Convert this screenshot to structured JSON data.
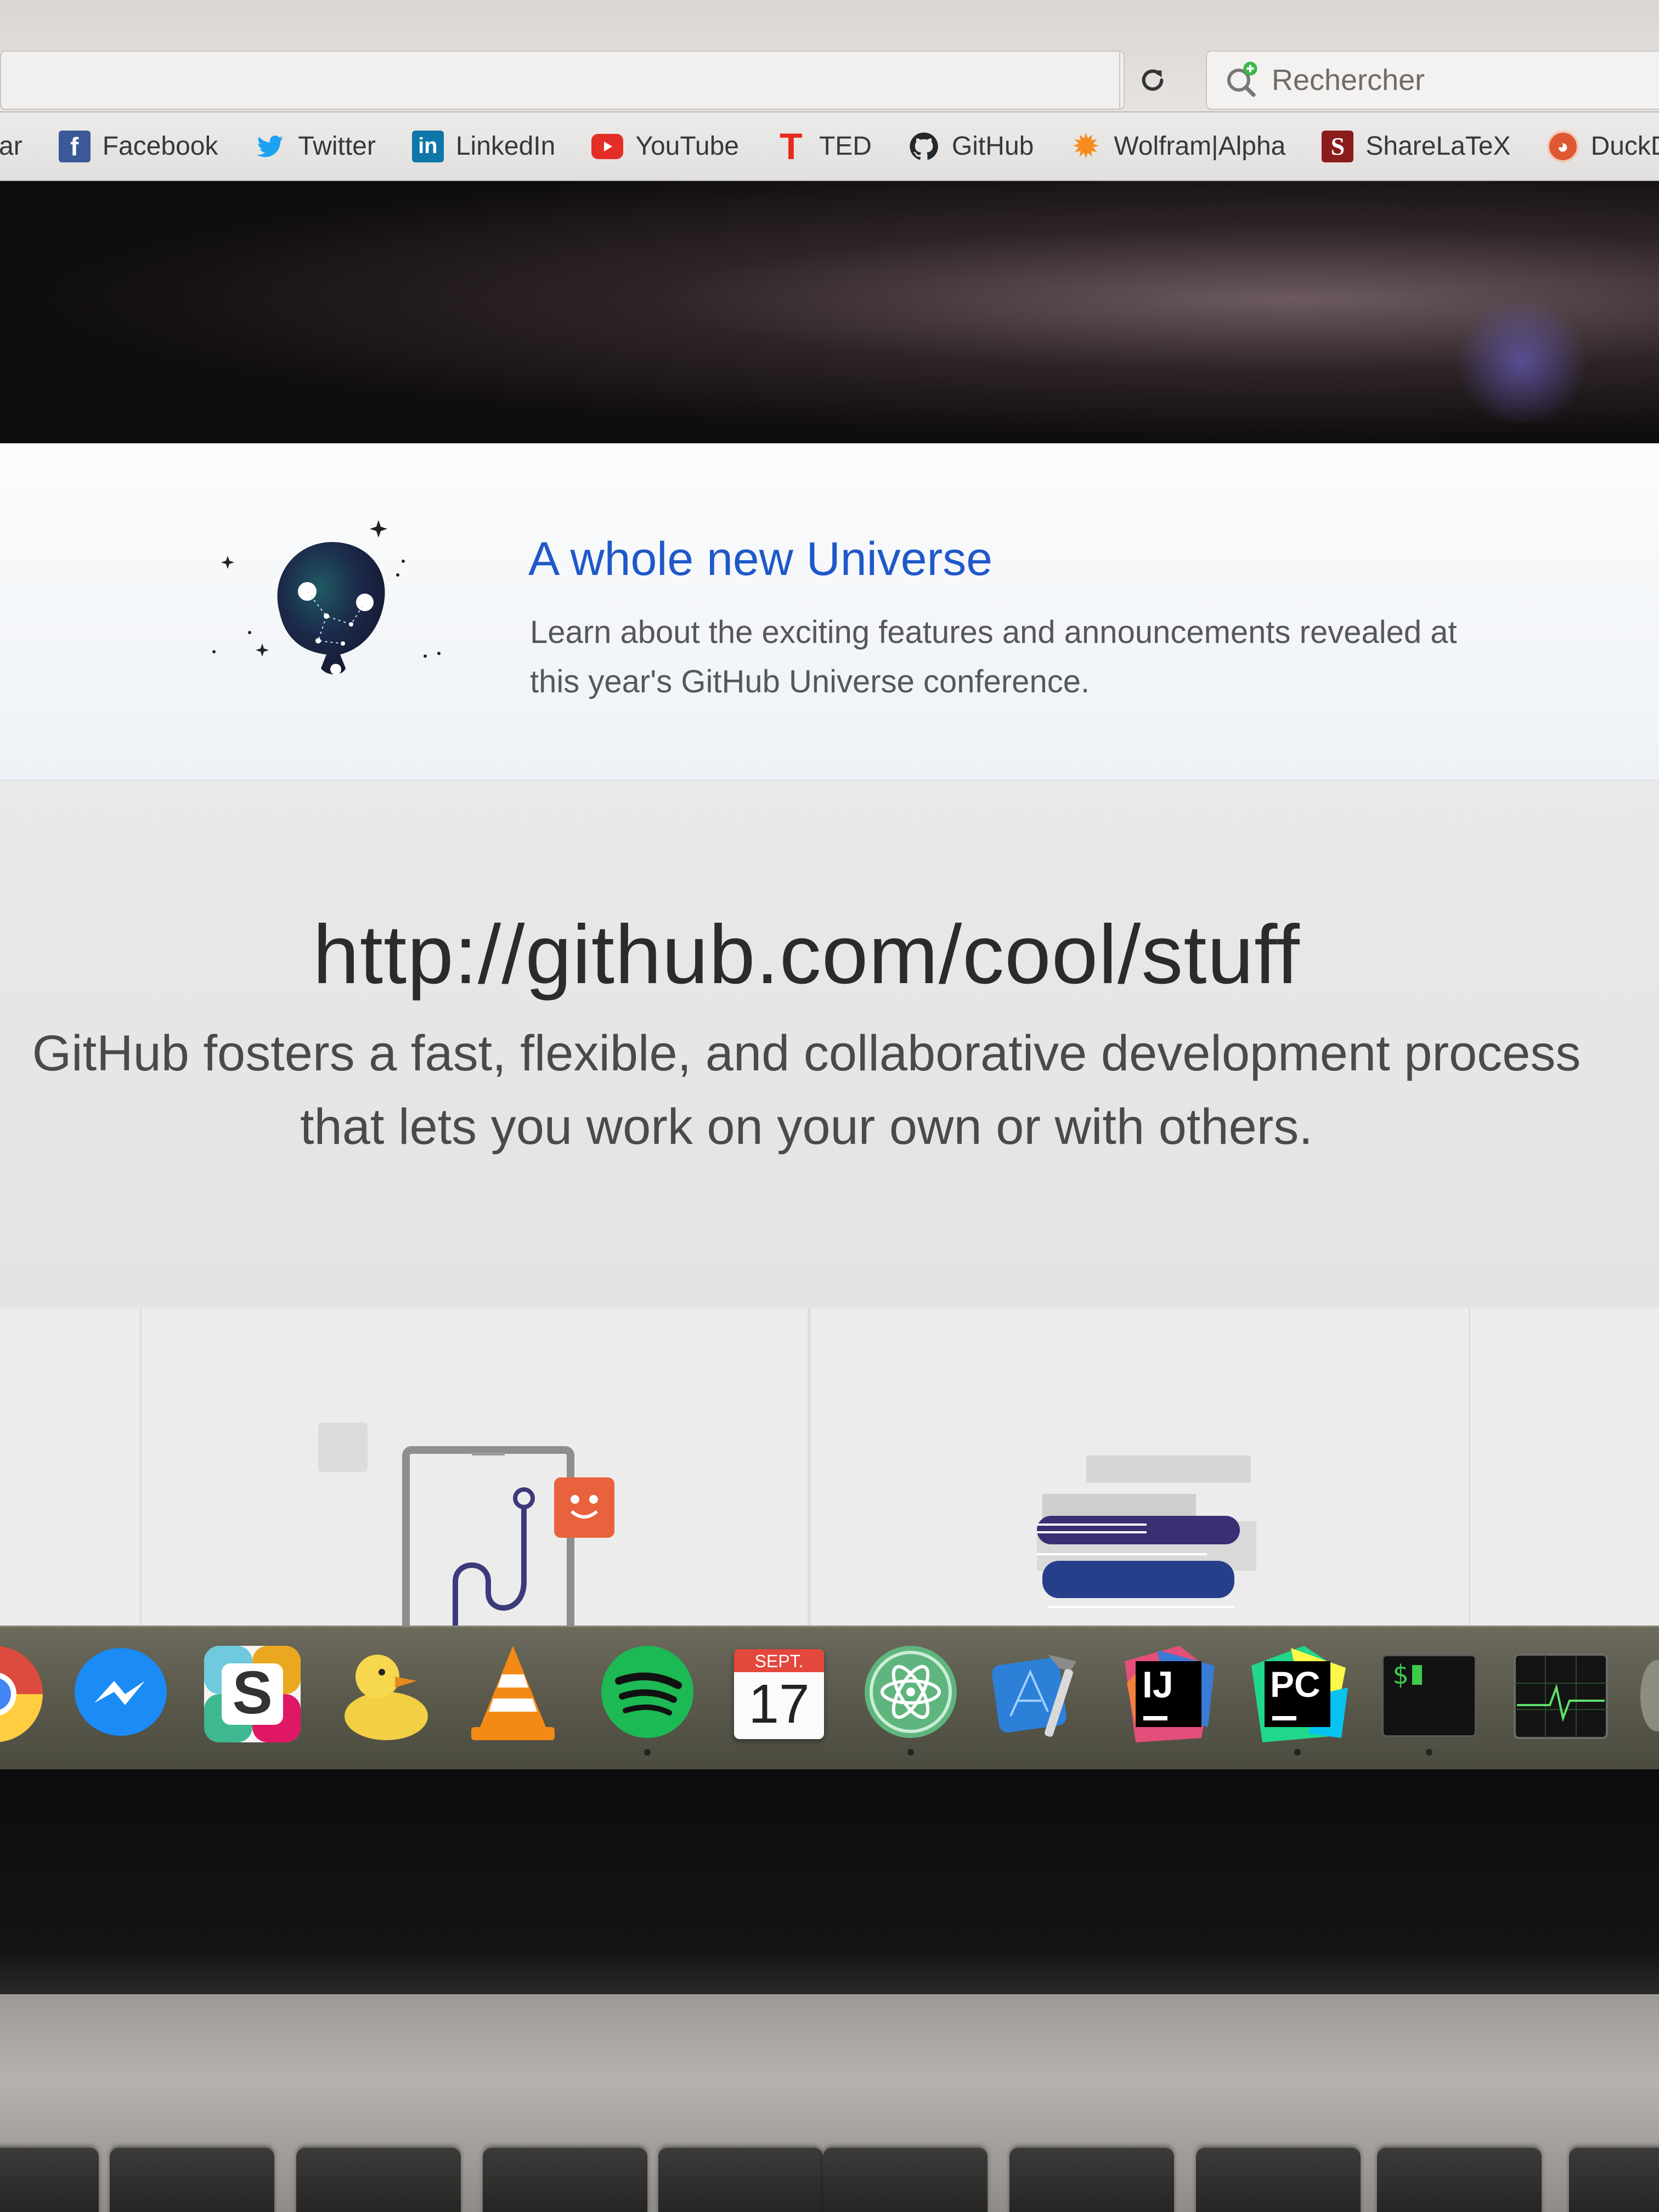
{
  "browser": {
    "search_placeholder": "Rechercher",
    "bookmarks": [
      {
        "label": "ar",
        "icon": "truncated-bookmark",
        "color": ""
      },
      {
        "label": "Facebook",
        "icon": "facebook-icon",
        "color": "#3b5998"
      },
      {
        "label": "Twitter",
        "icon": "twitter-icon",
        "color": "#1da1f2"
      },
      {
        "label": "LinkedIn",
        "icon": "linkedin-icon",
        "color": "#0e76a8"
      },
      {
        "label": "YouTube",
        "icon": "youtube-icon",
        "color": "#e52d27"
      },
      {
        "label": "TED",
        "icon": "ted-icon",
        "color": "#e62b1e"
      },
      {
        "label": "GitHub",
        "icon": "github-icon",
        "color": "#24292e"
      },
      {
        "label": "Wolfram|Alpha",
        "icon": "wolframalpha-icon",
        "color": "#f78b1f"
      },
      {
        "label": "ShareLaTeX",
        "icon": "sharelatex-icon",
        "color": "#8a1c1c"
      },
      {
        "label": "DuckDu",
        "icon": "duckduckgo-icon",
        "color": "#de5833"
      }
    ]
  },
  "universe": {
    "title": "A whole new Universe",
    "description": "Learn about the exciting features and announcements revealed at this year's GitHub Universe conference.",
    "title_color": "#1f58c9"
  },
  "features": {
    "url": "http://github.com/cool/stuff",
    "description_line1": "GitHub fosters a fast, flexible, and collaborative development process",
    "description_line2": "that lets you work on your own or with others."
  },
  "dock": {
    "apps": [
      {
        "name": "chrome-icon",
        "running": false
      },
      {
        "name": "messenger-icon",
        "running": false
      },
      {
        "name": "slack-icon",
        "running": false,
        "letter": "S"
      },
      {
        "name": "cyberduck-icon",
        "running": false
      },
      {
        "name": "vlc-icon",
        "running": false
      },
      {
        "name": "spotify-icon",
        "running": true
      },
      {
        "name": "calendar-icon",
        "running": false,
        "month": "SEPT.",
        "day": "17"
      },
      {
        "name": "atom-icon",
        "running": true
      },
      {
        "name": "xcode-icon",
        "running": false
      },
      {
        "name": "intellij-icon",
        "running": false,
        "letters": "IJ"
      },
      {
        "name": "pycharm-icon",
        "running": true,
        "letters": "PC"
      },
      {
        "name": "terminal-icon",
        "running": true,
        "prompt": "$"
      },
      {
        "name": "activity-monitor-icon",
        "running": false
      }
    ]
  }
}
